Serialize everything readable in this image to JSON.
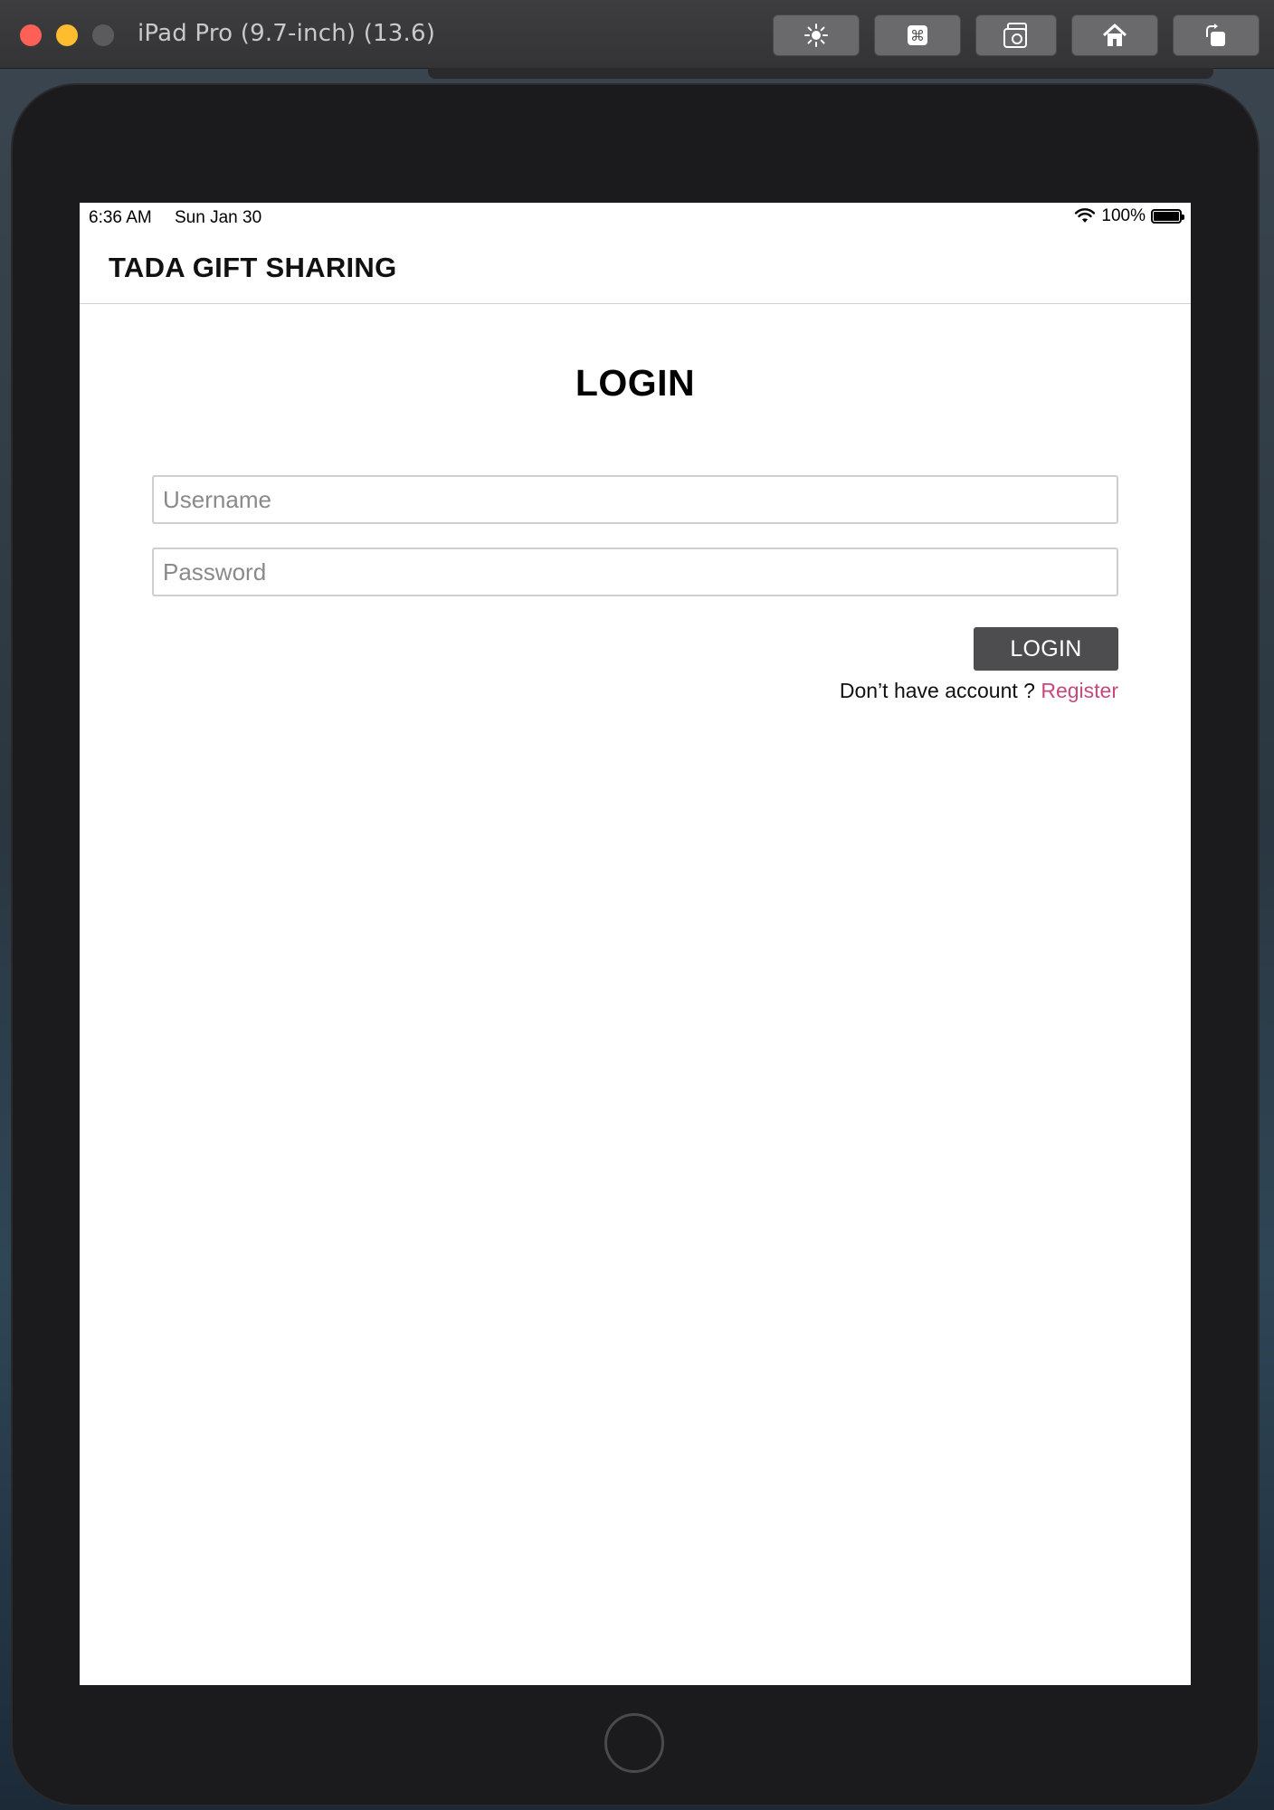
{
  "window": {
    "title": "iPad Pro (9.7-inch) (13.6)",
    "toolbar_icons": [
      "brightness-icon",
      "command-icon",
      "screenshot-icon",
      "home-icon",
      "rotate-icon"
    ]
  },
  "status_bar": {
    "time": "6:36 AM",
    "date": "Sun Jan 30",
    "battery_percent": "100%"
  },
  "app": {
    "title": "TADA GIFT SHARING"
  },
  "login": {
    "heading": "LOGIN",
    "username_placeholder": "Username",
    "password_placeholder": "Password",
    "button_label": "LOGIN",
    "no_account_text": "Don’t have account ? ",
    "register_label": "Register"
  },
  "colors": {
    "register_link": "#c9477a",
    "login_button_bg": "#4d4d4f"
  }
}
